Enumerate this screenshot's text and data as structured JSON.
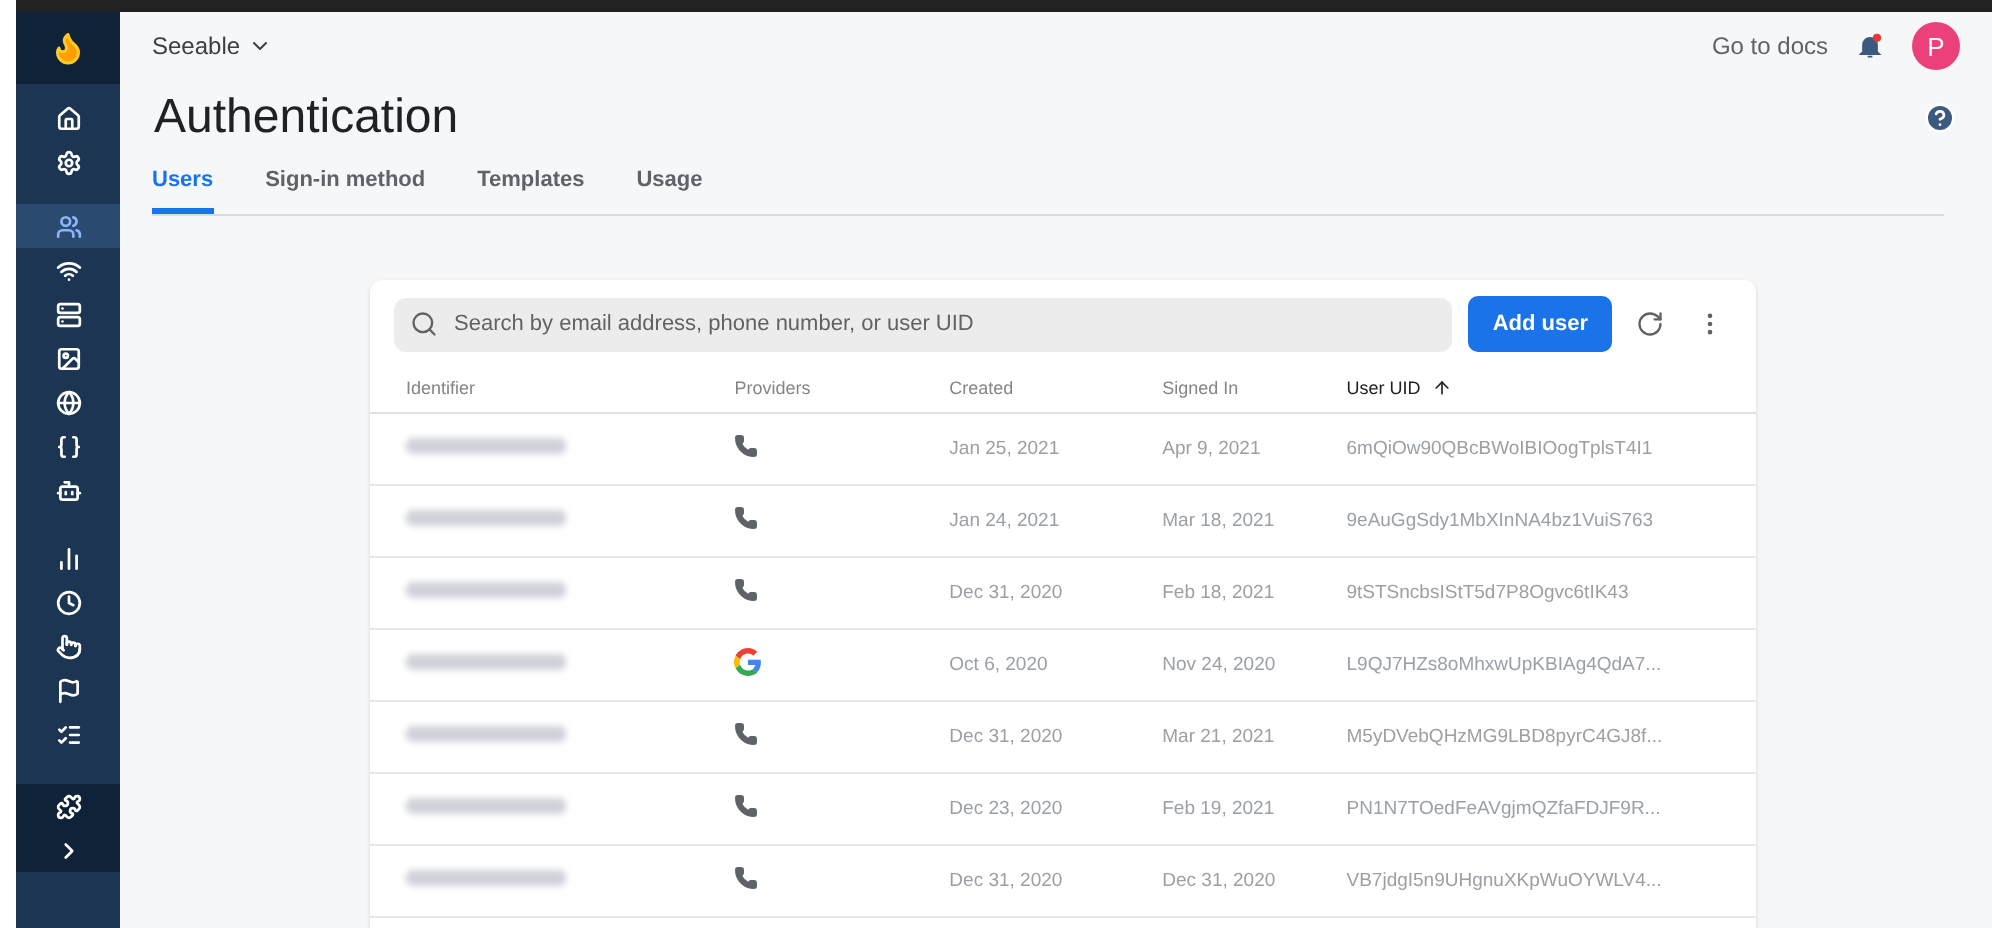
{
  "project": {
    "name": "Seeable"
  },
  "header": {
    "docs_link": "Go to docs",
    "avatar": "P"
  },
  "title": "Authentication",
  "tabs": [
    {
      "label": "Users",
      "selected": true
    },
    {
      "label": "Sign-in method",
      "selected": false
    },
    {
      "label": "Templates",
      "selected": false
    },
    {
      "label": "Usage",
      "selected": false
    }
  ],
  "sidebar": {
    "items": [
      {
        "selected": false
      },
      {
        "selected": false
      },
      {
        "selected": true
      },
      {
        "selected": false
      },
      {
        "selected": false
      },
      {
        "selected": false
      },
      {
        "selected": false
      },
      {
        "selected": false
      },
      {
        "selected": false
      },
      {
        "selected": false
      },
      {
        "selected": false
      },
      {
        "selected": false
      },
      {
        "selected": false
      },
      {
        "selected": false
      },
      {
        "selected": false
      },
      {
        "selected": false
      }
    ]
  },
  "search": {
    "placeholder": "Search by email address, phone number, or user UID"
  },
  "add_button": "Add user",
  "table": {
    "columns": [
      {
        "label": "Identifier",
        "sorted": false
      },
      {
        "label": "Providers",
        "sorted": false
      },
      {
        "label": "Created",
        "sorted": false
      },
      {
        "label": "Signed In",
        "sorted": false
      },
      {
        "label": "User UID",
        "sorted": true
      }
    ],
    "rows": [
      {
        "kind": "phone",
        "created": "Jan 25, 2021",
        "signed_in": "Apr 9, 2021",
        "uid": "6mQiOw90QBcBWoIBIOogTplsT4I1"
      },
      {
        "kind": "phone",
        "created": "Jan 24, 2021",
        "signed_in": "Mar 18, 2021",
        "uid": "9eAuGgSdy1MbXInNA4bz1VuiS763"
      },
      {
        "kind": "phone",
        "created": "Dec 31, 2020",
        "signed_in": "Feb 18, 2021",
        "uid": "9tSTSncbsIStT5d7P8Ogvc6tIK43"
      },
      {
        "kind": "google",
        "created": "Oct 6, 2020",
        "signed_in": "Nov 24, 2020",
        "uid": "L9QJ7HZs8oMhxwUpKBIAg4QdA7..."
      },
      {
        "kind": "phone",
        "created": "Dec 31, 2020",
        "signed_in": "Mar 21, 2021",
        "uid": "M5yDVebQHzMG9LBD8pyrC4GJ8f..."
      },
      {
        "kind": "phone",
        "created": "Dec 23, 2020",
        "signed_in": "Feb 19, 2021",
        "uid": "PN1N7TOedFeAVgjmQZfaFDJF9R..."
      },
      {
        "kind": "phone",
        "created": "Dec 31, 2020",
        "signed_in": "Dec 31, 2020",
        "uid": "VB7jdgI5n9UHgnuXKpWuOYWLV4..."
      }
    ]
  }
}
